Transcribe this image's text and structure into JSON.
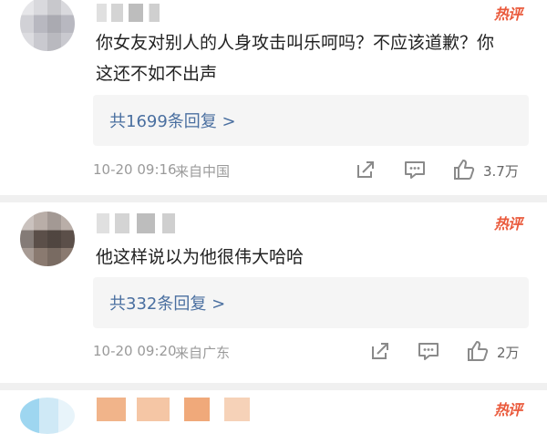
{
  "comments": [
    {
      "hot_tag": "热评",
      "text": "你女友对别人的人身攻击叫乐呵吗？不应该道歉？你这还不如不出声",
      "replies_label": "共1699条回复 >",
      "timestamp": "10-20 09:16",
      "source": "来自中国",
      "like_count": "3.7万"
    },
    {
      "hot_tag": "热评",
      "text": "他这样说以为他很伟大哈哈",
      "replies_label": "共332条回复 >",
      "timestamp": "10-20 09:20",
      "source": "来自广东",
      "like_count": "2万"
    },
    {
      "hot_tag": "热评"
    }
  ],
  "icons": {
    "share": "share-icon",
    "reply": "comment-icon",
    "like": "thumbs-up-icon"
  },
  "colors": {
    "hot_tag": "#ea5a3c",
    "reply_link": "#4a6fa0",
    "meta_text": "#9a9a9a",
    "reply_box_bg": "#f5f5f5"
  }
}
